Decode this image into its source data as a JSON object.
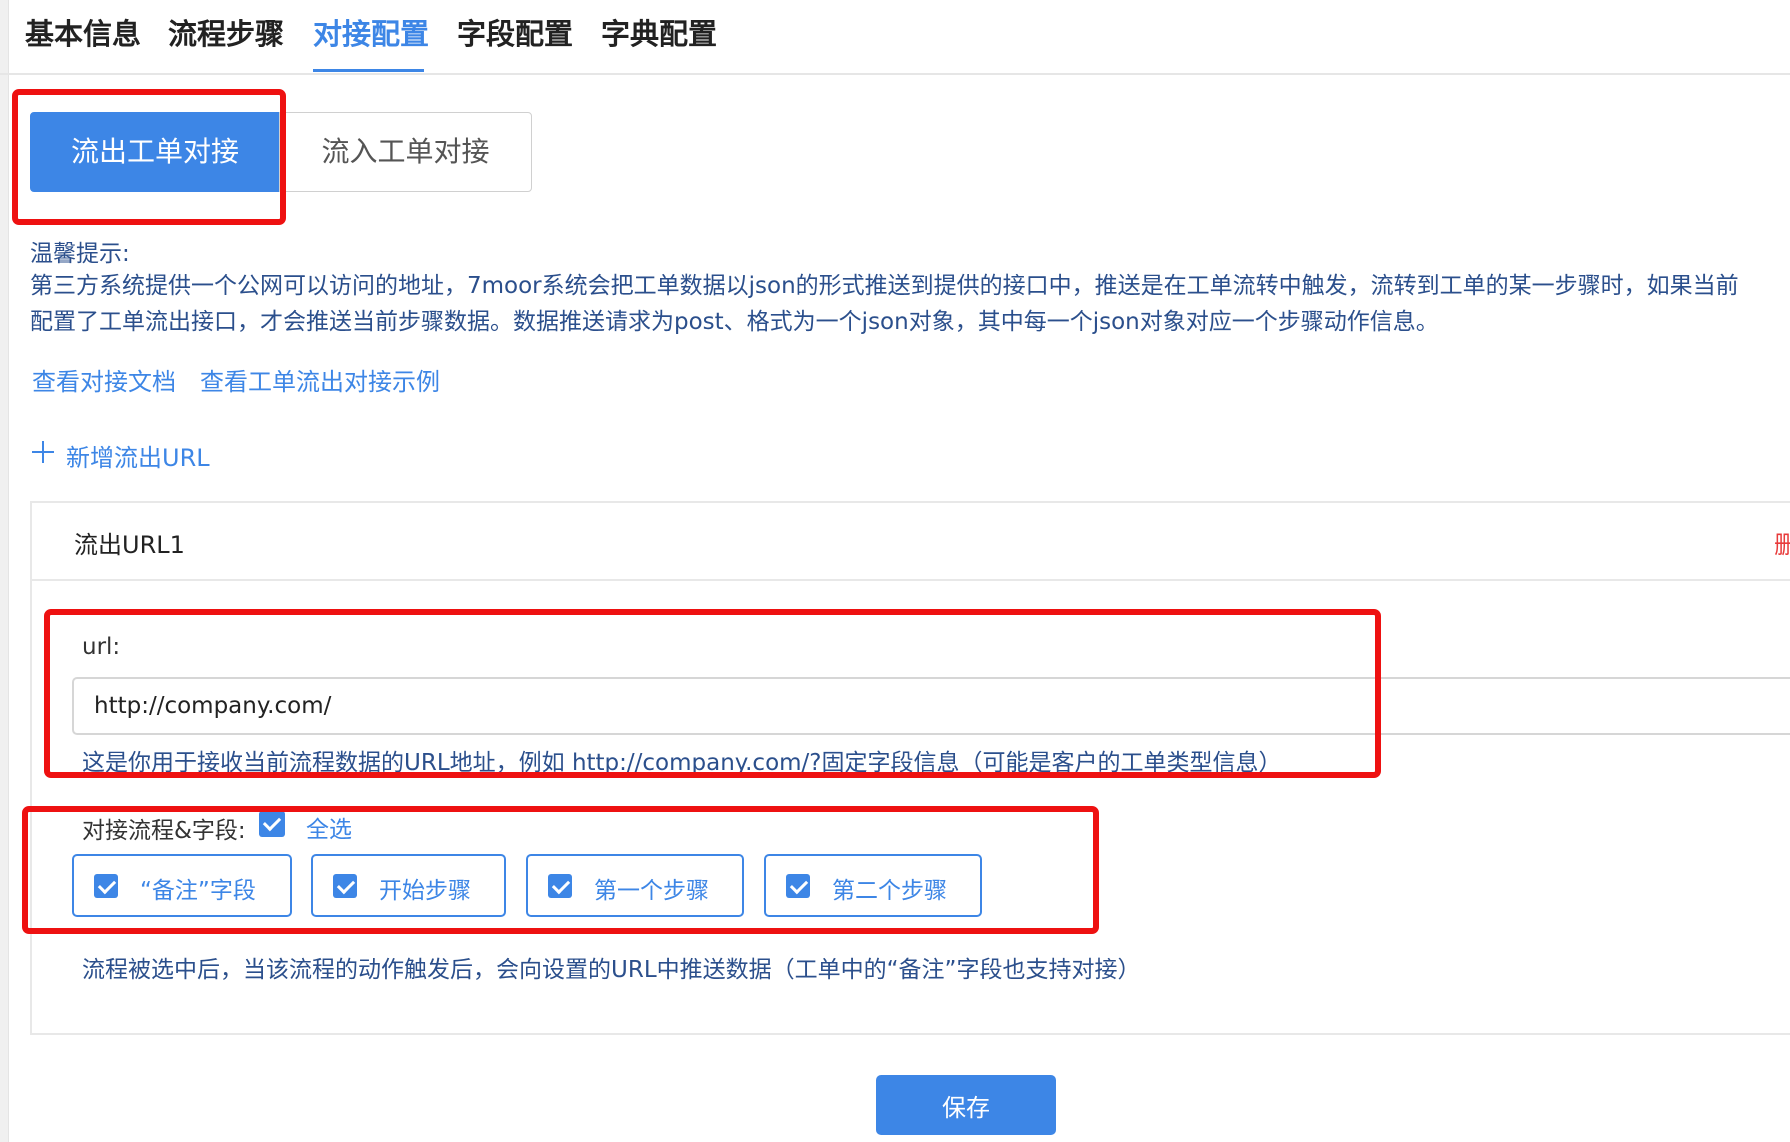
{
  "tabs": [
    "基本信息",
    "流程步骤",
    "对接配置",
    "字段配置",
    "字典配置"
  ],
  "active_tab": "对接配置",
  "segment": {
    "outflow": "流出工单对接",
    "inflow": "流入工单对接",
    "selected": "流出工单对接"
  },
  "hint": {
    "title": "温馨提示:",
    "line1": "第三方系统提供一个公网可以访问的地址，7moor系统会把工单数据以json的形式推送到提供的接口中，推送是在工单流转中触发，流转到工单的某一步骤时，如果当前",
    "line2": "配置了工单流出接口，才会推送当前步骤数据。数据推送请求为post、格式为一个json对象，其中每一个json对象对应一个步骤动作信息。"
  },
  "links": {
    "doc": "查看对接文档",
    "example": "查看工单流出对接示例"
  },
  "add_url_label": "新增流出URL",
  "outflow_card": {
    "title": "流出URL1",
    "delete_label": "删",
    "url_label": "url:",
    "url_value": "http://company.com/",
    "url_help": "这是你用于接收当前流程数据的URL地址，例如 http://company.com/?固定字段信息（可能是客户的工单类型信息）",
    "fields_label": "对接流程&字段:",
    "select_all": "全选",
    "select_all_checked": true,
    "options": [
      {
        "label": "“备注”字段",
        "checked": true
      },
      {
        "label": "开始步骤",
        "checked": true
      },
      {
        "label": "第一个步骤",
        "checked": true
      },
      {
        "label": "第二个步骤",
        "checked": true
      }
    ],
    "footnote": "流程被选中后，当该流程的动作触发后，会向设置的URL中推送数据（工单中的“备注”字段也支持对接）"
  },
  "save_label": "保存",
  "colors": {
    "primary": "#3d86e6",
    "annotation": "#ee1111",
    "hint_text": "#2b4f8c",
    "danger": "#e83b3b"
  }
}
